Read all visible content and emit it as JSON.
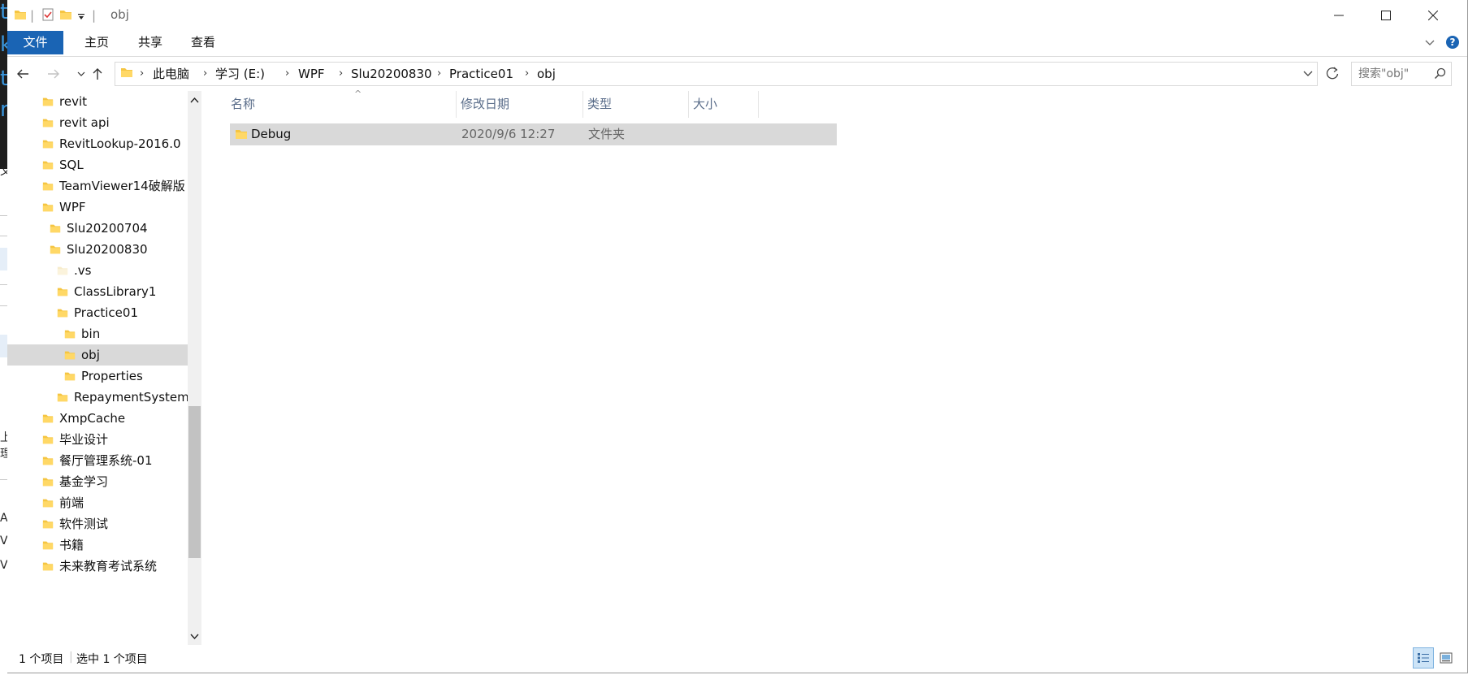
{
  "window": {
    "title": "obj",
    "minimize_label": "—",
    "maximize_label": "☐",
    "close_label": "✕"
  },
  "ribbon": {
    "tabs": [
      "文件",
      "主页",
      "共享",
      "查看"
    ],
    "help_label": "?"
  },
  "address": {
    "crumbs": [
      "此电脑",
      "学习 (E:)",
      "WPF",
      "Slu20200830",
      "Practice01",
      "obj"
    ]
  },
  "search": {
    "placeholder": "搜索\"obj\""
  },
  "nav_tree": [
    {
      "label": "revit",
      "indent": 0
    },
    {
      "label": "revit api",
      "indent": 0
    },
    {
      "label": "RevitLookup-2016.0",
      "indent": 0
    },
    {
      "label": "SQL",
      "indent": 0
    },
    {
      "label": "TeamViewer14破解版",
      "indent": 0
    },
    {
      "label": "WPF",
      "indent": 0
    },
    {
      "label": "Slu20200704",
      "indent": 1
    },
    {
      "label": "Slu20200830",
      "indent": 1
    },
    {
      "label": ".vs",
      "indent": 2,
      "faded": true
    },
    {
      "label": "ClassLibrary1",
      "indent": 2
    },
    {
      "label": "Practice01",
      "indent": 2
    },
    {
      "label": "bin",
      "indent": 3
    },
    {
      "label": "obj",
      "indent": 3,
      "selected": true
    },
    {
      "label": "Properties",
      "indent": 3
    },
    {
      "label": "RepaymentSystem",
      "indent": 2
    },
    {
      "label": "XmpCache",
      "indent": 0
    },
    {
      "label": "毕业设计",
      "indent": 0
    },
    {
      "label": "餐厅管理系统-01",
      "indent": 0
    },
    {
      "label": "基金学习",
      "indent": 0
    },
    {
      "label": "前端",
      "indent": 0
    },
    {
      "label": "软件测试",
      "indent": 0
    },
    {
      "label": "书籍",
      "indent": 0
    },
    {
      "label": "未来教育考试系统",
      "indent": 0
    }
  ],
  "columns": {
    "name": "名称",
    "modified": "修改日期",
    "type": "类型",
    "size": "大小"
  },
  "files": [
    {
      "name": "Debug",
      "modified": "2020/9/6 12:27",
      "type": "文件夹",
      "size": ""
    }
  ],
  "status": {
    "item_count": "1 个项目",
    "selected": "选中 1 个项目"
  },
  "colors": {
    "accent": "#1a64b4",
    "selection": "#d9d9d9",
    "folder": "#f5c542",
    "header_text": "#5a6d8a"
  }
}
